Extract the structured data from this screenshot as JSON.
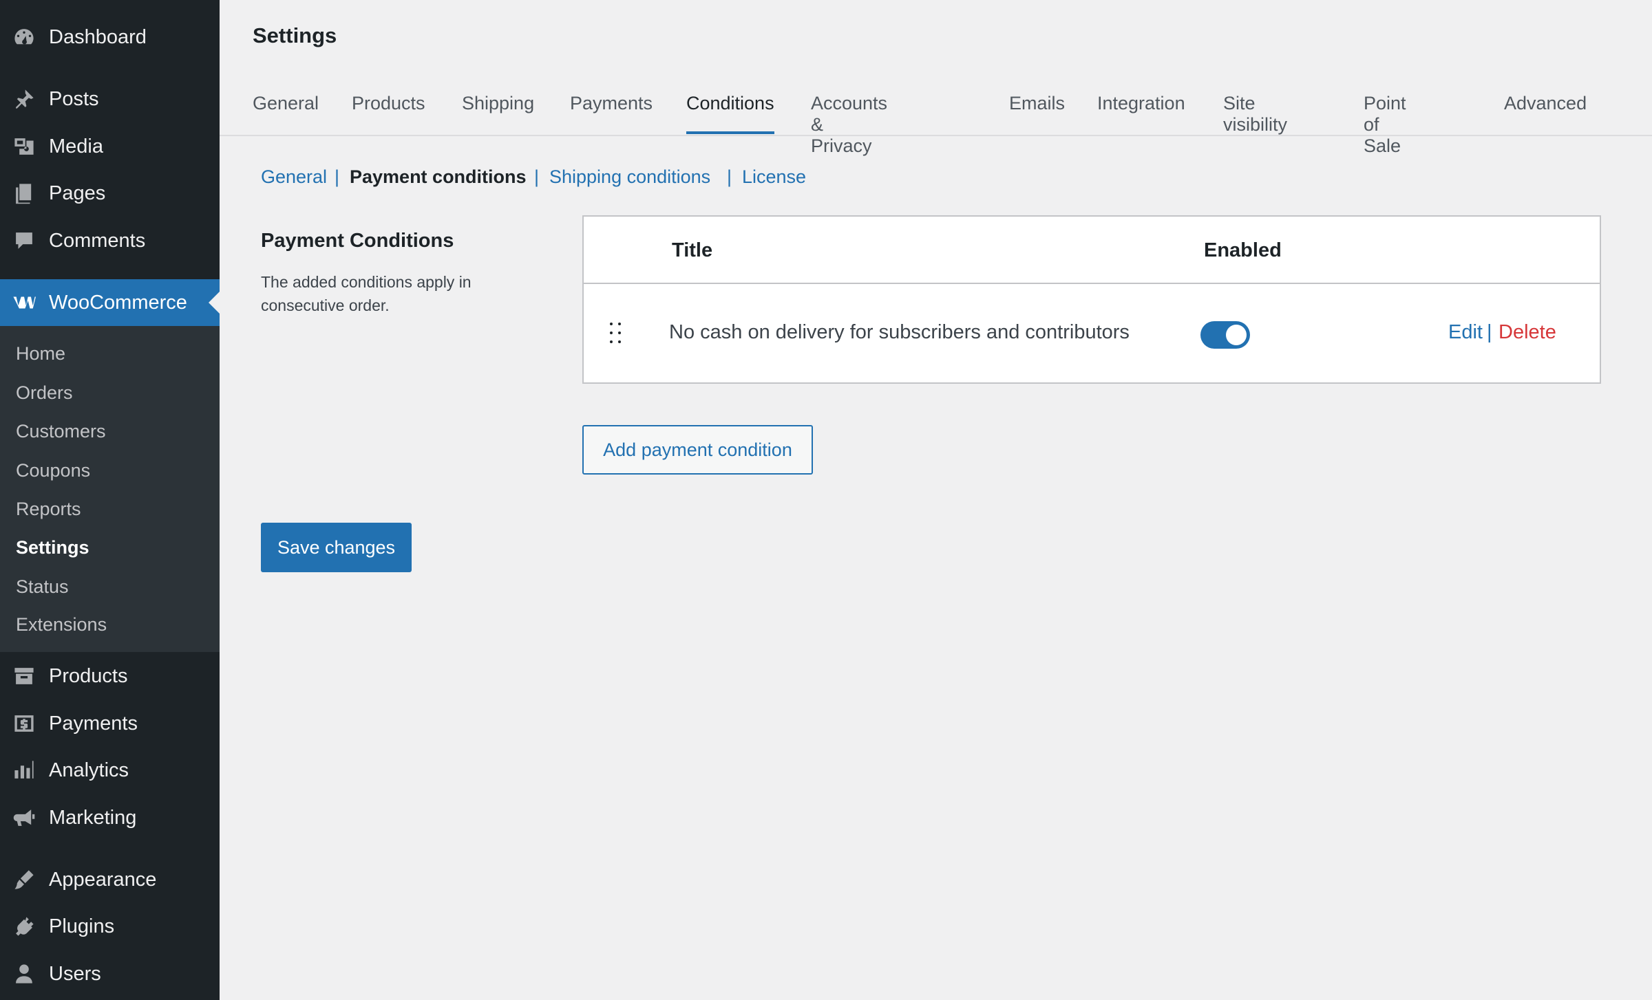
{
  "sidebar": {
    "items": [
      {
        "label": "Dashboard",
        "icon": "dashboard-icon"
      },
      {
        "label": "Posts",
        "icon": "pin-icon"
      },
      {
        "label": "Media",
        "icon": "media-icon"
      },
      {
        "label": "Pages",
        "icon": "pages-icon"
      },
      {
        "label": "Comments",
        "icon": "comment-icon"
      },
      {
        "label": "WooCommerce",
        "icon": "woocommerce-icon"
      },
      {
        "label": "Products",
        "icon": "archive-icon"
      },
      {
        "label": "Payments",
        "icon": "dollar-icon"
      },
      {
        "label": "Analytics",
        "icon": "bar-chart-icon"
      },
      {
        "label": "Marketing",
        "icon": "megaphone-icon"
      },
      {
        "label": "Appearance",
        "icon": "brush-icon"
      },
      {
        "label": "Plugins",
        "icon": "plug-icon"
      },
      {
        "label": "Users",
        "icon": "user-icon"
      }
    ],
    "submenu": [
      "Home",
      "Orders",
      "Customers",
      "Coupons",
      "Reports",
      "Settings",
      "Status",
      "Extensions"
    ],
    "submenu_current": "Settings"
  },
  "page": {
    "title": "Settings"
  },
  "tabs": [
    "General",
    "Products",
    "Shipping",
    "Payments",
    "Conditions",
    "Accounts & Privacy",
    "Emails",
    "Integration",
    "Site visibility",
    "Point of Sale",
    "Advanced"
  ],
  "tabs_active": "Conditions",
  "subnav": {
    "general": "General",
    "payment": "Payment conditions",
    "shipping": "Shipping conditions",
    "license": "License",
    "separator": "|"
  },
  "section": {
    "heading": "Payment Conditions",
    "description": "The added conditions apply in consecutive order."
  },
  "table": {
    "headers": {
      "title": "Title",
      "enabled": "Enabled"
    },
    "rows": [
      {
        "title": "No cash on delivery for subscribers and contributors",
        "enabled": true,
        "edit": "Edit",
        "separator": "|",
        "delete": "Delete"
      }
    ]
  },
  "buttons": {
    "add": "Add payment condition",
    "save": "Save changes"
  },
  "colors": {
    "sidebar_bg": "#1d2327",
    "accent": "#2271b1",
    "danger": "#d63638"
  }
}
